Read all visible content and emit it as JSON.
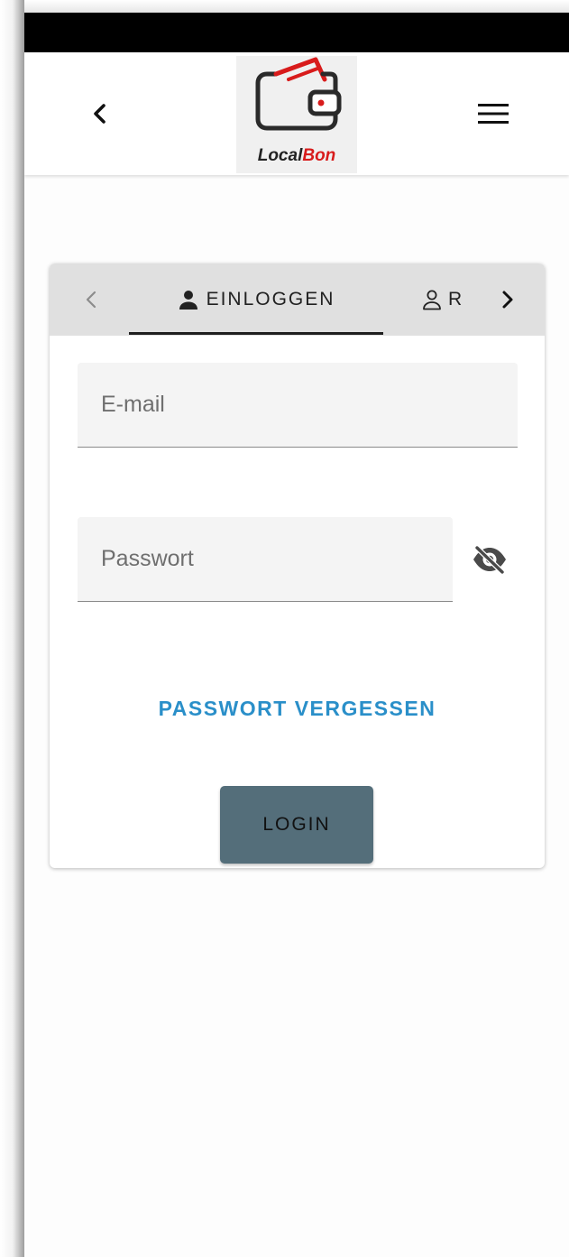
{
  "app": {
    "logo_text_part1": "Local",
    "logo_text_part2": "Bon",
    "brand_color": "#d81b1b"
  },
  "header": {
    "back_icon": "chevron-left-icon",
    "menu_icon": "hamburger-menu-icon"
  },
  "tabs": [
    {
      "label": "EINLOGGEN",
      "icon": "person-filled-icon",
      "active": true
    },
    {
      "label": "R",
      "icon": "person-outline-icon",
      "active": false
    }
  ],
  "form": {
    "email_placeholder": "E-mail",
    "email_value": "",
    "password_placeholder": "Passwort",
    "password_value": "",
    "password_toggle_icon": "eye-off-icon",
    "forgot_password_label": "PASSWORT VERGESSEN",
    "login_label": "LOGIN"
  },
  "colors": {
    "accent_link": "#2a8fc9",
    "login_button": "#546e7a",
    "tab_bar": "#e0e0e0"
  }
}
